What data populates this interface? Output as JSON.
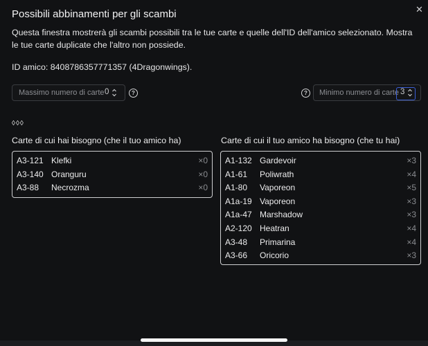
{
  "dialog": {
    "title": "Possibili abbinamenti per gli scambi",
    "close_icon": "✕",
    "description": "Questa finestra mostrerà gli scambi possibili tra le tue carte e quelle dell'ID dell'amico selezionato. Mostra le tue carte duplicate che l'altro non possiede.",
    "friend_id": "ID amico: 8408786357771357 (4Dragonwings)."
  },
  "controls": {
    "max_cards": {
      "placeholder": "Massimo numero di carte",
      "value": "0"
    },
    "min_cards": {
      "placeholder": "Minimo numero di carte",
      "value": "3"
    },
    "help_glyph": "?"
  },
  "diamonds": "◊◊◊",
  "needed": {
    "title": "Carte di cui hai bisogno (che il tuo amico ha)",
    "rows": [
      {
        "code": "A3-121",
        "name": "Klefki",
        "qty": "×0"
      },
      {
        "code": "A3-140",
        "name": "Oranguru",
        "qty": "×0"
      },
      {
        "code": "A3-88",
        "name": "Necrozma",
        "qty": "×0"
      }
    ]
  },
  "friend_needs": {
    "title": "Carte di cui il tuo amico ha bisogno (che tu hai)",
    "rows": [
      {
        "code": "A1-132",
        "name": "Gardevoir",
        "qty": "×3"
      },
      {
        "code": "A1-61",
        "name": "Poliwrath",
        "qty": "×4"
      },
      {
        "code": "A1-80",
        "name": "Vaporeon",
        "qty": "×5"
      },
      {
        "code": "A1a-19",
        "name": "Vaporeon",
        "qty": "×3"
      },
      {
        "code": "A1a-47",
        "name": "Marshadow",
        "qty": "×3"
      },
      {
        "code": "A2-120",
        "name": "Heatran",
        "qty": "×4"
      },
      {
        "code": "A3-48",
        "name": "Primarina",
        "qty": "×4"
      },
      {
        "code": "A3-66",
        "name": "Oricorio",
        "qty": "×3"
      }
    ]
  }
}
